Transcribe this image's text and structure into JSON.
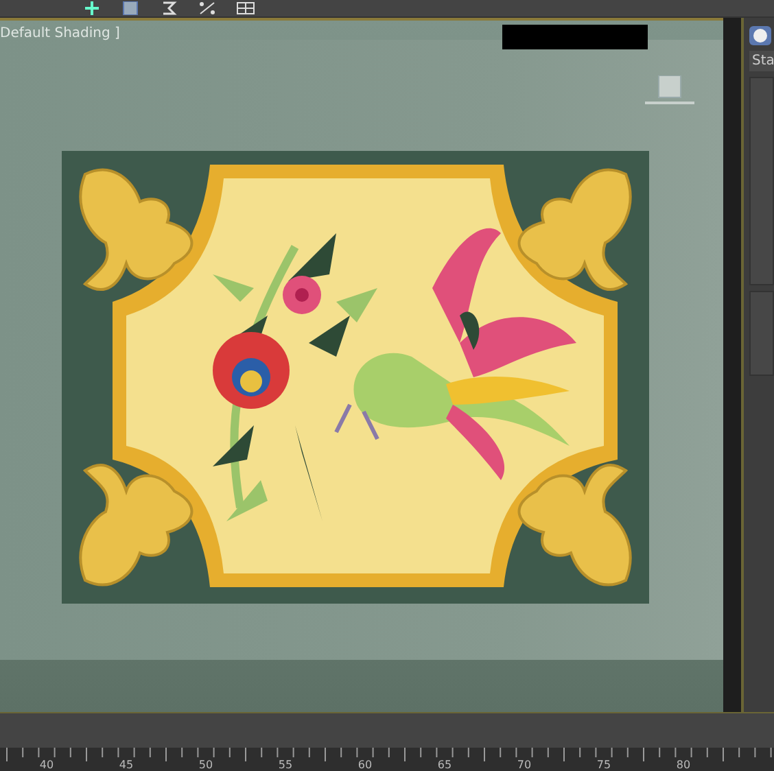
{
  "viewport": {
    "label": "Default Shading ]"
  },
  "command_panel": {
    "tab": "Sta"
  },
  "timeline": {
    "ruler_labels": [
      "40",
      "45",
      "50",
      "55",
      "60",
      "65",
      "70",
      "75",
      "80"
    ]
  }
}
